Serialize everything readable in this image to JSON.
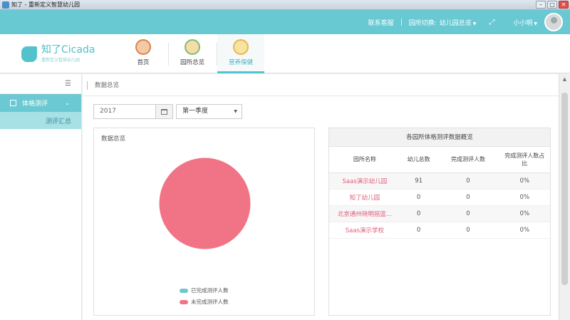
{
  "window": {
    "title": "知了 - 重新定义智慧幼儿园",
    "min_glyph": "–",
    "max_glyph": "□",
    "close_glyph": "✕"
  },
  "topbar": {
    "service": "联系客服",
    "switch_label": "园所切换:",
    "switch_value": "幼儿园总览",
    "user": "小小明"
  },
  "logo": {
    "brand": "知了Cicada",
    "slogan": "重新定义智慧幼儿园"
  },
  "nav": {
    "tabs": [
      {
        "label": "首页"
      },
      {
        "label": "园所总览"
      },
      {
        "label": "营养保健"
      }
    ]
  },
  "sidebar": {
    "menu_label": "体格测评",
    "submenu_label": "测评汇总"
  },
  "main": {
    "breadcrumb": "数据总览",
    "filter": {
      "year": "2017",
      "season": "第一季度"
    },
    "left_panel": {
      "title": "数据总览",
      "legend": [
        {
          "label": "已完成测评人数",
          "color": "#6dc7cf"
        },
        {
          "label": "未完成测评人数",
          "color": "#f07485"
        }
      ],
      "chart_data": {
        "type": "pie",
        "categories": [
          "已完成测评人数",
          "未完成测评人数"
        ],
        "values": [
          0,
          91
        ],
        "colors": [
          "#6dc7cf",
          "#f07485"
        ]
      }
    },
    "right_panel": {
      "title": "各园所体格测评数据概览",
      "columns": [
        "园所名称",
        "幼儿总数",
        "完成测评人数",
        "完成测评人数占比"
      ],
      "rows": [
        [
          "Saas演示幼儿园",
          "91",
          "0",
          "0%"
        ],
        [
          "知了幼儿园",
          "0",
          "0",
          "0%"
        ],
        [
          "北京通州晓明摇篮...",
          "0",
          "0",
          "0%"
        ],
        [
          "Saas演示学校",
          "0",
          "0",
          "0%"
        ]
      ]
    }
  },
  "scrollbar": {
    "up_glyph": "▲"
  }
}
